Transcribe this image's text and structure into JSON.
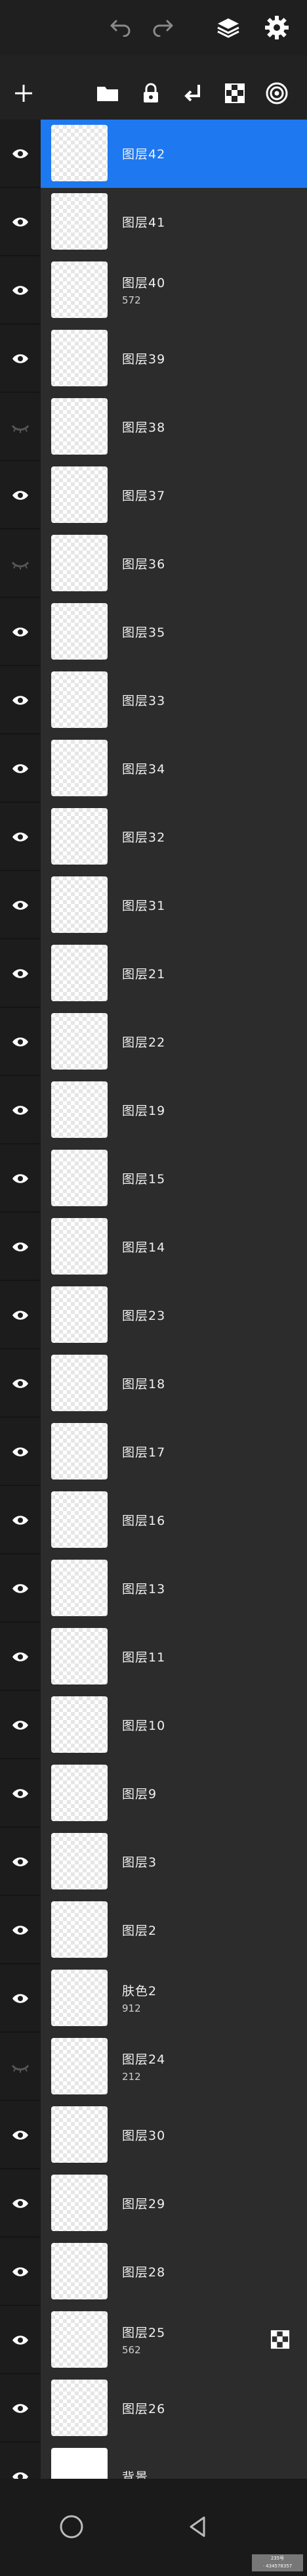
{
  "colors": {
    "accent": "#1e78f0",
    "background": "#202020",
    "row": "#2c2c2c"
  },
  "topbar": {
    "undo_icon": "undo-arrow-icon",
    "redo_icon": "redo-arrow-icon",
    "layers_icon": "layers-stack-icon",
    "settings_icon": "gear-icon"
  },
  "toolbar": {
    "add_icon": "plus-icon",
    "folder_icon": "folder-icon",
    "lock_icon": "lock-icon",
    "merge_down_icon": "merge-down-arrow-icon",
    "transparency_icon": "checker-icon",
    "blend_icon": "concentric-circles-icon"
  },
  "layers": [
    {
      "name": "图层42",
      "sub": "",
      "visible": true,
      "selected": true
    },
    {
      "name": "图层41",
      "sub": "",
      "visible": true
    },
    {
      "name": "图层40",
      "sub": "572",
      "visible": true
    },
    {
      "name": "图层39",
      "sub": "",
      "visible": true
    },
    {
      "name": "图层38",
      "sub": "",
      "visible": false
    },
    {
      "name": "图层37",
      "sub": "",
      "visible": true
    },
    {
      "name": "图层36",
      "sub": "",
      "visible": false
    },
    {
      "name": "图层35",
      "sub": "",
      "visible": true
    },
    {
      "name": "图层33",
      "sub": "",
      "visible": true
    },
    {
      "name": "图层34",
      "sub": "",
      "visible": true
    },
    {
      "name": "图层32",
      "sub": "",
      "visible": true
    },
    {
      "name": "图层31",
      "sub": "",
      "visible": true
    },
    {
      "name": "图层21",
      "sub": "",
      "visible": true
    },
    {
      "name": "图层22",
      "sub": "",
      "visible": true
    },
    {
      "name": "图层19",
      "sub": "",
      "visible": true
    },
    {
      "name": "图层15",
      "sub": "",
      "visible": true
    },
    {
      "name": "图层14",
      "sub": "",
      "visible": true
    },
    {
      "name": "图层23",
      "sub": "",
      "visible": true
    },
    {
      "name": "图层18",
      "sub": "",
      "visible": true
    },
    {
      "name": "图层17",
      "sub": "",
      "visible": true
    },
    {
      "name": "图层16",
      "sub": "",
      "visible": true
    },
    {
      "name": "图层13",
      "sub": "",
      "visible": true
    },
    {
      "name": "图层11",
      "sub": "",
      "visible": true
    },
    {
      "name": "图层10",
      "sub": "",
      "visible": true
    },
    {
      "name": "图层9",
      "sub": "",
      "visible": true
    },
    {
      "name": "图层3",
      "sub": "",
      "visible": true
    },
    {
      "name": "图层2",
      "sub": "",
      "visible": true
    },
    {
      "name": "肤色2",
      "sub": "912",
      "visible": true
    },
    {
      "name": "图层24",
      "sub": "212",
      "visible": false
    },
    {
      "name": "图层30",
      "sub": "",
      "visible": true
    },
    {
      "name": "图层29",
      "sub": "",
      "visible": true
    },
    {
      "name": "图层28",
      "sub": "",
      "visible": true
    },
    {
      "name": "图层25",
      "sub": "562",
      "visible": true,
      "side_icon": "checker-icon"
    },
    {
      "name": "图层26",
      "sub": "",
      "visible": true
    },
    {
      "name": "背景",
      "sub": "",
      "visible": true,
      "background": true
    }
  ],
  "bottombar": {
    "home_icon": "circle-home-icon",
    "back_icon": "triangle-back-icon"
  },
  "watermark": {
    "line1": "235号",
    "line2": "· 434578357"
  }
}
